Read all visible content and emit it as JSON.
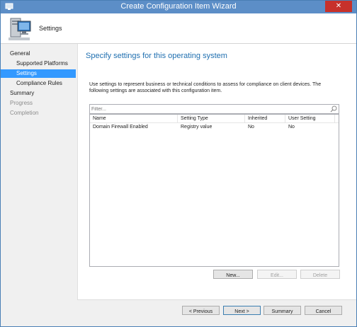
{
  "window": {
    "title": "Create Configuration Item Wizard",
    "close_glyph": "✕"
  },
  "header": {
    "title": "Settings",
    "icon": "computer-icon"
  },
  "sidebar": {
    "items": [
      {
        "label": "General",
        "level": "top",
        "state": "normal"
      },
      {
        "label": "Supported Platforms",
        "level": "sub",
        "state": "normal"
      },
      {
        "label": "Settings",
        "level": "sub",
        "state": "active"
      },
      {
        "label": "Compliance Rules",
        "level": "sub",
        "state": "normal"
      },
      {
        "label": "Summary",
        "level": "top",
        "state": "normal"
      },
      {
        "label": "Progress",
        "level": "top",
        "state": "disabled"
      },
      {
        "label": "Completion",
        "level": "top",
        "state": "disabled"
      }
    ]
  },
  "main": {
    "title": "Specify settings for this operating system",
    "description": "Use settings to represent business or technical conditions to assess for compliance on client devices. The following settings are associated with this configuration item.",
    "filter_placeholder": "Filter...",
    "columns": [
      "Name",
      "Setting Type",
      "Inherited",
      "User Setting"
    ],
    "rows": [
      [
        "Domain Firewall Enabled",
        "Registry value",
        "No",
        "No"
      ]
    ],
    "buttons": {
      "new": "New...",
      "edit": "Edit...",
      "delete": "Delete"
    }
  },
  "footer": {
    "previous": "< Previous",
    "next": "Next >",
    "summary": "Summary",
    "cancel": "Cancel"
  },
  "colors": {
    "titlebar": "#5c8ec7",
    "accent_title": "#1f6fb0",
    "selection": "#3399ff"
  }
}
